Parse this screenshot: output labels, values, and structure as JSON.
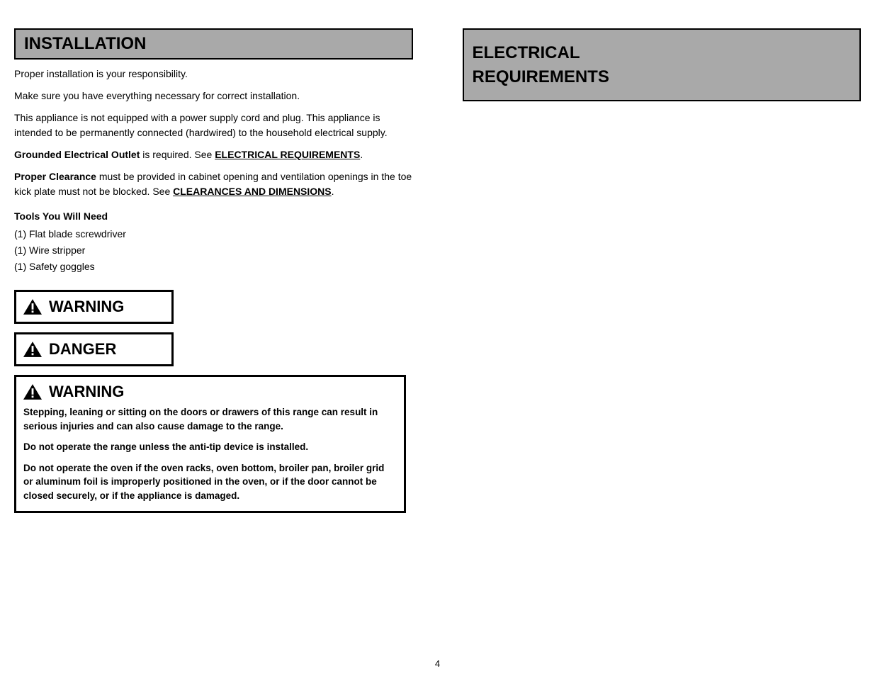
{
  "left": {
    "header": "INSTALLATION",
    "intro_lines": [
      "Proper installation is your responsibility.",
      "Make sure you have everything necessary for correct installation.",
      "This appliance is not equipped with a power supply cord and plug. This appliance is intended to be permanently connected (hardwired) to the household electrical supply."
    ],
    "grounded_title_bold": "Grounded Electrical Outlet ",
    "grounded_title_plain": "is required. See ",
    "grounded_title_link": "ELECTRICAL REQUIREMENTS",
    "grounded_title_tail": ".",
    "clearances_bold": "Proper Clearance ",
    "clearances_plain": "must be provided in cabinet opening and ventilation openings in the toe kick plate must not be blocked. See ",
    "clearances_link": "CLEARANCES AND DIMENSIONS",
    "clearances_tail": ".",
    "tools_title": "Tools You Will Need",
    "tools_list": [
      "(1) Flat blade screwdriver",
      "(1) Wire stripper",
      "(1) Safety goggles"
    ],
    "warning1": {
      "label": "WARNING"
    },
    "danger": {
      "label": "DANGER"
    },
    "warning2": {
      "label": "WARNING",
      "body_lines": [
        "Stepping, leaning or sitting on the doors or drawers of this range can result in serious injuries and can also cause damage to the range.",
        "Do not operate the range unless the anti-tip device is installed.",
        "Do not operate the oven if the oven racks, oven bottom, broiler pan, broiler grid or aluminum foil is improperly positioned in the oven, or if the door cannot be closed securely, or if the appliance is damaged."
      ]
    }
  },
  "right": {
    "header_lines": [
      "ELECTRICAL",
      "REQUIREMENTS"
    ]
  },
  "page_number": "4"
}
